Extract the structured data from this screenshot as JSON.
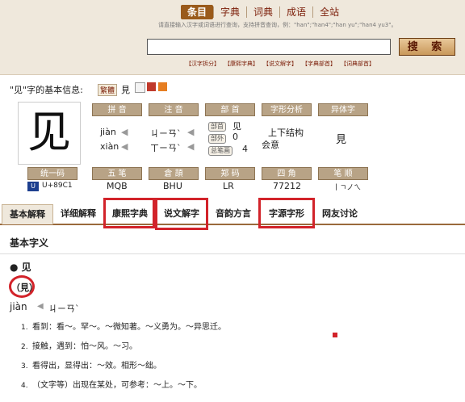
{
  "nav": {
    "items": [
      "条目",
      "字典",
      "词典",
      "成语",
      "全站"
    ]
  },
  "search": {
    "hint": "请直接输入汉字或词语进行查询，支持拼音查询，例：\"han\";\"han4\";\"han yu\";\"han4 yu3\"。",
    "placeholder": "",
    "button_label": "搜 索"
  },
  "quick_links": [
    "【汉字拆分】",
    "【康熙字典】",
    "【说文解字】",
    "【字典部首】",
    "【词典部首】"
  ],
  "info": {
    "title": "\"见\"字的基本信息:",
    "badge_label": "繁體",
    "badge_char": "見",
    "big_char": "见",
    "labels": {
      "pinyin": "拼 音",
      "zhuyin": "注 音",
      "bushou": "部 首",
      "zixing": "字形分析",
      "yiti": "异体字",
      "unicode": "统一码",
      "wubi": "五 笔",
      "cangjie": "倉 頡",
      "zhengma": "郑 码",
      "sijiao": "四 角",
      "bishun": "笔 顺"
    },
    "pinyin": [
      "jiàn",
      "xiàn"
    ],
    "zhuyin": [
      "ㄐㄧㄢˋ",
      "ㄒㄧㄢˋ"
    ],
    "bushou_labels": [
      "部首",
      "部外",
      "总笔画"
    ],
    "bushou_values": [
      "见",
      "0",
      "4"
    ],
    "zixing": [
      "上下结构",
      "会意"
    ],
    "yiti": "見",
    "unicode": "U+89C1",
    "wubi": "MQB",
    "cangjie": "BHU",
    "zhengma": "LR",
    "sijiao": "77212",
    "bishun": "丨ㄱノㄟ"
  },
  "tabs": [
    "基本解释",
    "详细解释",
    "康熙字典",
    "说文解字",
    "音韵方言",
    "字源字形",
    "网友讨论"
  ],
  "main": {
    "section_title": "基本字义",
    "char_head": "● 见",
    "trad": "（見）",
    "pron": "jiàn",
    "pron_zhuyin": "ㄐㄧㄢˋ",
    "defs": [
      {
        "n": "1.",
        "t": "看到：看～。罕～。～微知著。～义勇为。～异思迁。"
      },
      {
        "n": "2.",
        "t": "接触，遇到：怕～风。～习。"
      },
      {
        "n": "3.",
        "t": "看得出，显得出：～效。相形～绌。"
      },
      {
        "n": "4.",
        "t": "（文字等）出现在某处，可参考：～上。～下。"
      }
    ]
  },
  "colors": {
    "accent": "#9a5a1a",
    "highlight": "#d2232a"
  }
}
